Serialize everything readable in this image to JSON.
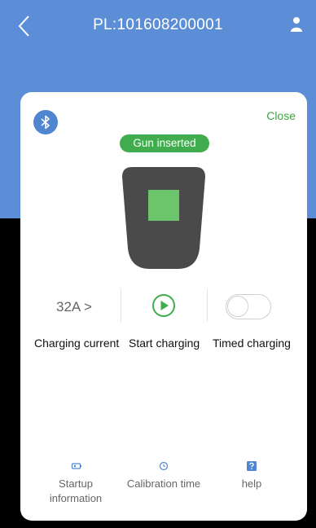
{
  "header": {
    "title": "PL:101608200001"
  },
  "card": {
    "close_label": "Close",
    "status_badge": "Gun inserted",
    "charging_current_value": "32A >",
    "controls": {
      "charging_current": "Charging current",
      "start_charging": "Start charging",
      "timed_charging": "Timed charging"
    },
    "footer": {
      "startup_information_line1": "Startup",
      "startup_information_line2": "information",
      "calibration_time": "Calibration time",
      "help": "help"
    }
  },
  "colors": {
    "header_blue": "#5b8ed6",
    "accent_green": "#3fad4d",
    "charger_body": "#4a4a4a",
    "charger_screen": "#6cc56a"
  },
  "icons": {
    "back": "chevron-left-icon",
    "user": "user-icon",
    "bluetooth": "bluetooth-icon",
    "play": "play-circle-icon",
    "startup": "battery-info-icon",
    "calibration": "clock-icon",
    "help": "help-icon"
  },
  "state": {
    "timed_charging_enabled": false
  }
}
